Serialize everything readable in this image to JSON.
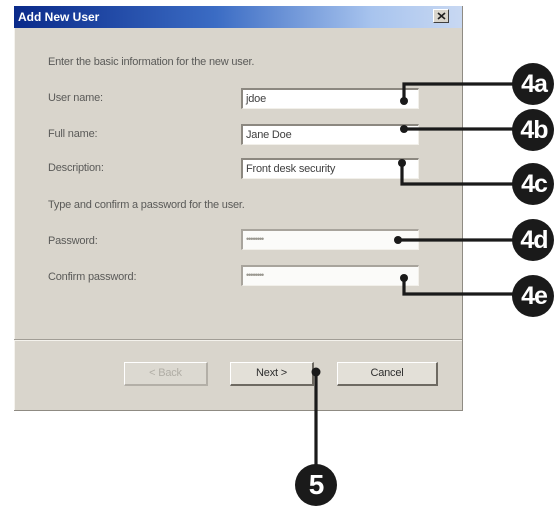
{
  "dialog": {
    "title": "Add New User",
    "intro_text": "Enter the basic information for the new user.",
    "fields": {
      "user_name": {
        "label": "User name:",
        "value": "jdoe"
      },
      "full_name": {
        "label": "Full name:",
        "value": "Jane Doe"
      },
      "description": {
        "label": "Description:",
        "value": "Front desk security"
      }
    },
    "password_intro": "Type and confirm a password for the user.",
    "password": {
      "label": "Password:",
      "value": "••••••••"
    },
    "confirm_password": {
      "label": "Confirm password:",
      "value": "••••••••"
    },
    "buttons": {
      "back": "< Back",
      "next": "Next >",
      "cancel": "Cancel"
    },
    "close_icon": "close-icon"
  },
  "callouts": {
    "user_name": "4a",
    "full_name": "4b",
    "description": "4c",
    "password": "4d",
    "confirm_password": "4e",
    "next": "5"
  },
  "colors": {
    "titlebar_start": "#0a2a8a",
    "titlebar_end": "#c8d8f2",
    "dialog_face": "#d9d5cc",
    "callout": "#1a1a1a"
  }
}
